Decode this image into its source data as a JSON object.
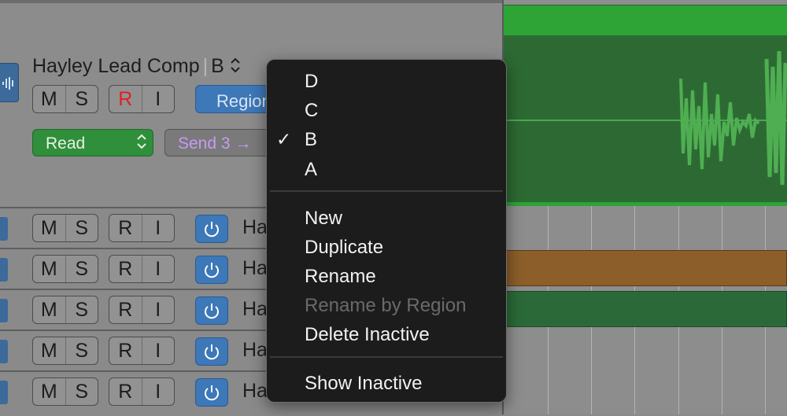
{
  "header": {
    "track_name": "Hayley Lead Comp",
    "take_separator": "|",
    "take_current": "B",
    "mute": "M",
    "solo": "S",
    "record": "R",
    "input_monitor": "I",
    "region_button": "Region",
    "automation_mode": "Read",
    "send_label": "Send 3 →"
  },
  "rows": [
    {
      "mute": "M",
      "solo": "S",
      "record": "R",
      "input": "I",
      "name": "Ha"
    },
    {
      "mute": "M",
      "solo": "S",
      "record": "R",
      "input": "I",
      "name": "Ha"
    },
    {
      "mute": "M",
      "solo": "S",
      "record": "R",
      "input": "I",
      "name": "Ha"
    },
    {
      "mute": "M",
      "solo": "S",
      "record": "R",
      "input": "I",
      "name": "Ha"
    },
    {
      "mute": "M",
      "solo": "S",
      "record": "R",
      "input": "I",
      "name": "Ha"
    }
  ],
  "menu": {
    "takes": [
      "D",
      "C",
      "B",
      "A"
    ],
    "checked_take": "B",
    "checkmark": "✓",
    "actions": [
      "New",
      "Duplicate",
      "Rename",
      "Rename by Region",
      "Delete Inactive"
    ],
    "disabled_action": "Rename by Region",
    "footer": "Show Inactive"
  },
  "colors": {
    "accent_blue": "#3d78b8",
    "read_green": "#2f8f3a",
    "region_green": "#2ea336",
    "region_brown": "#8c5e2a",
    "record_red": "#e0211a",
    "send_purple": "#c59af5"
  }
}
